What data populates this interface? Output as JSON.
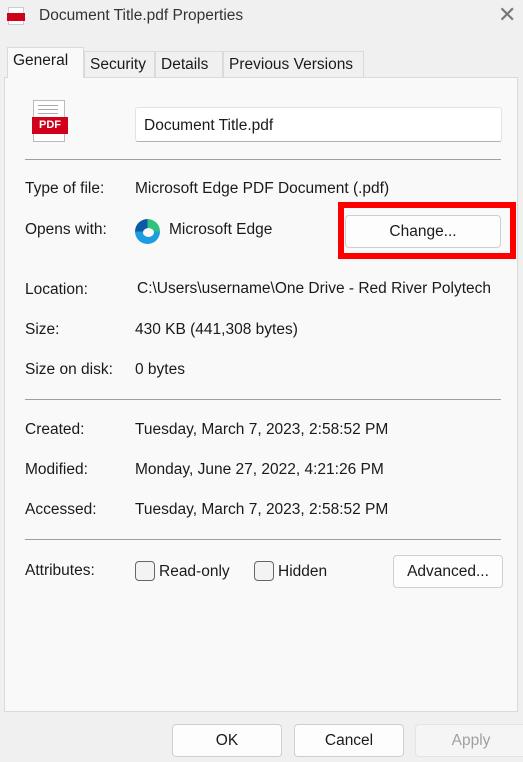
{
  "window": {
    "title": "Document Title.pdf Properties",
    "icon": "pdf-icon",
    "close_icon": "close-icon"
  },
  "tabs": [
    {
      "label": "General",
      "active": true
    },
    {
      "label": "Security"
    },
    {
      "label": "Details"
    },
    {
      "label": "Previous Versions"
    }
  ],
  "file": {
    "icon_label": "PDF",
    "name": "Document Title.pdf"
  },
  "rows": {
    "type_label": "Type of file:",
    "type_value": "Microsoft Edge PDF Document (.pdf)",
    "opens_label": "Opens with:",
    "opens_value": "Microsoft Edge",
    "change_label": "Change...",
    "location_label": "Location:",
    "location_value": "C:\\Users\\username\\One Drive - Red River Polytech",
    "size_label": "Size:",
    "size_value": "430 KB (441,308 bytes)",
    "disk_label": "Size on disk:",
    "disk_value": "0 bytes",
    "created_label": "Created:",
    "created_value": "Tuesday, March 7, 2023, 2:58:52 PM",
    "modified_label": "Modified:",
    "modified_value": "Monday, June 27, 2022, 4:21:26 PM",
    "accessed_label": "Accessed:",
    "accessed_value": "Tuesday, March 7, 2023, 2:58:52 PM"
  },
  "attributes": {
    "label": "Attributes:",
    "readonly": "Read-only",
    "readonly_checked": false,
    "hidden": "Hidden",
    "hidden_checked": false,
    "advanced": "Advanced..."
  },
  "footer": {
    "ok": "OK",
    "cancel": "Cancel",
    "apply": "Apply",
    "apply_disabled": true
  },
  "highlight_color": "#ff0000"
}
